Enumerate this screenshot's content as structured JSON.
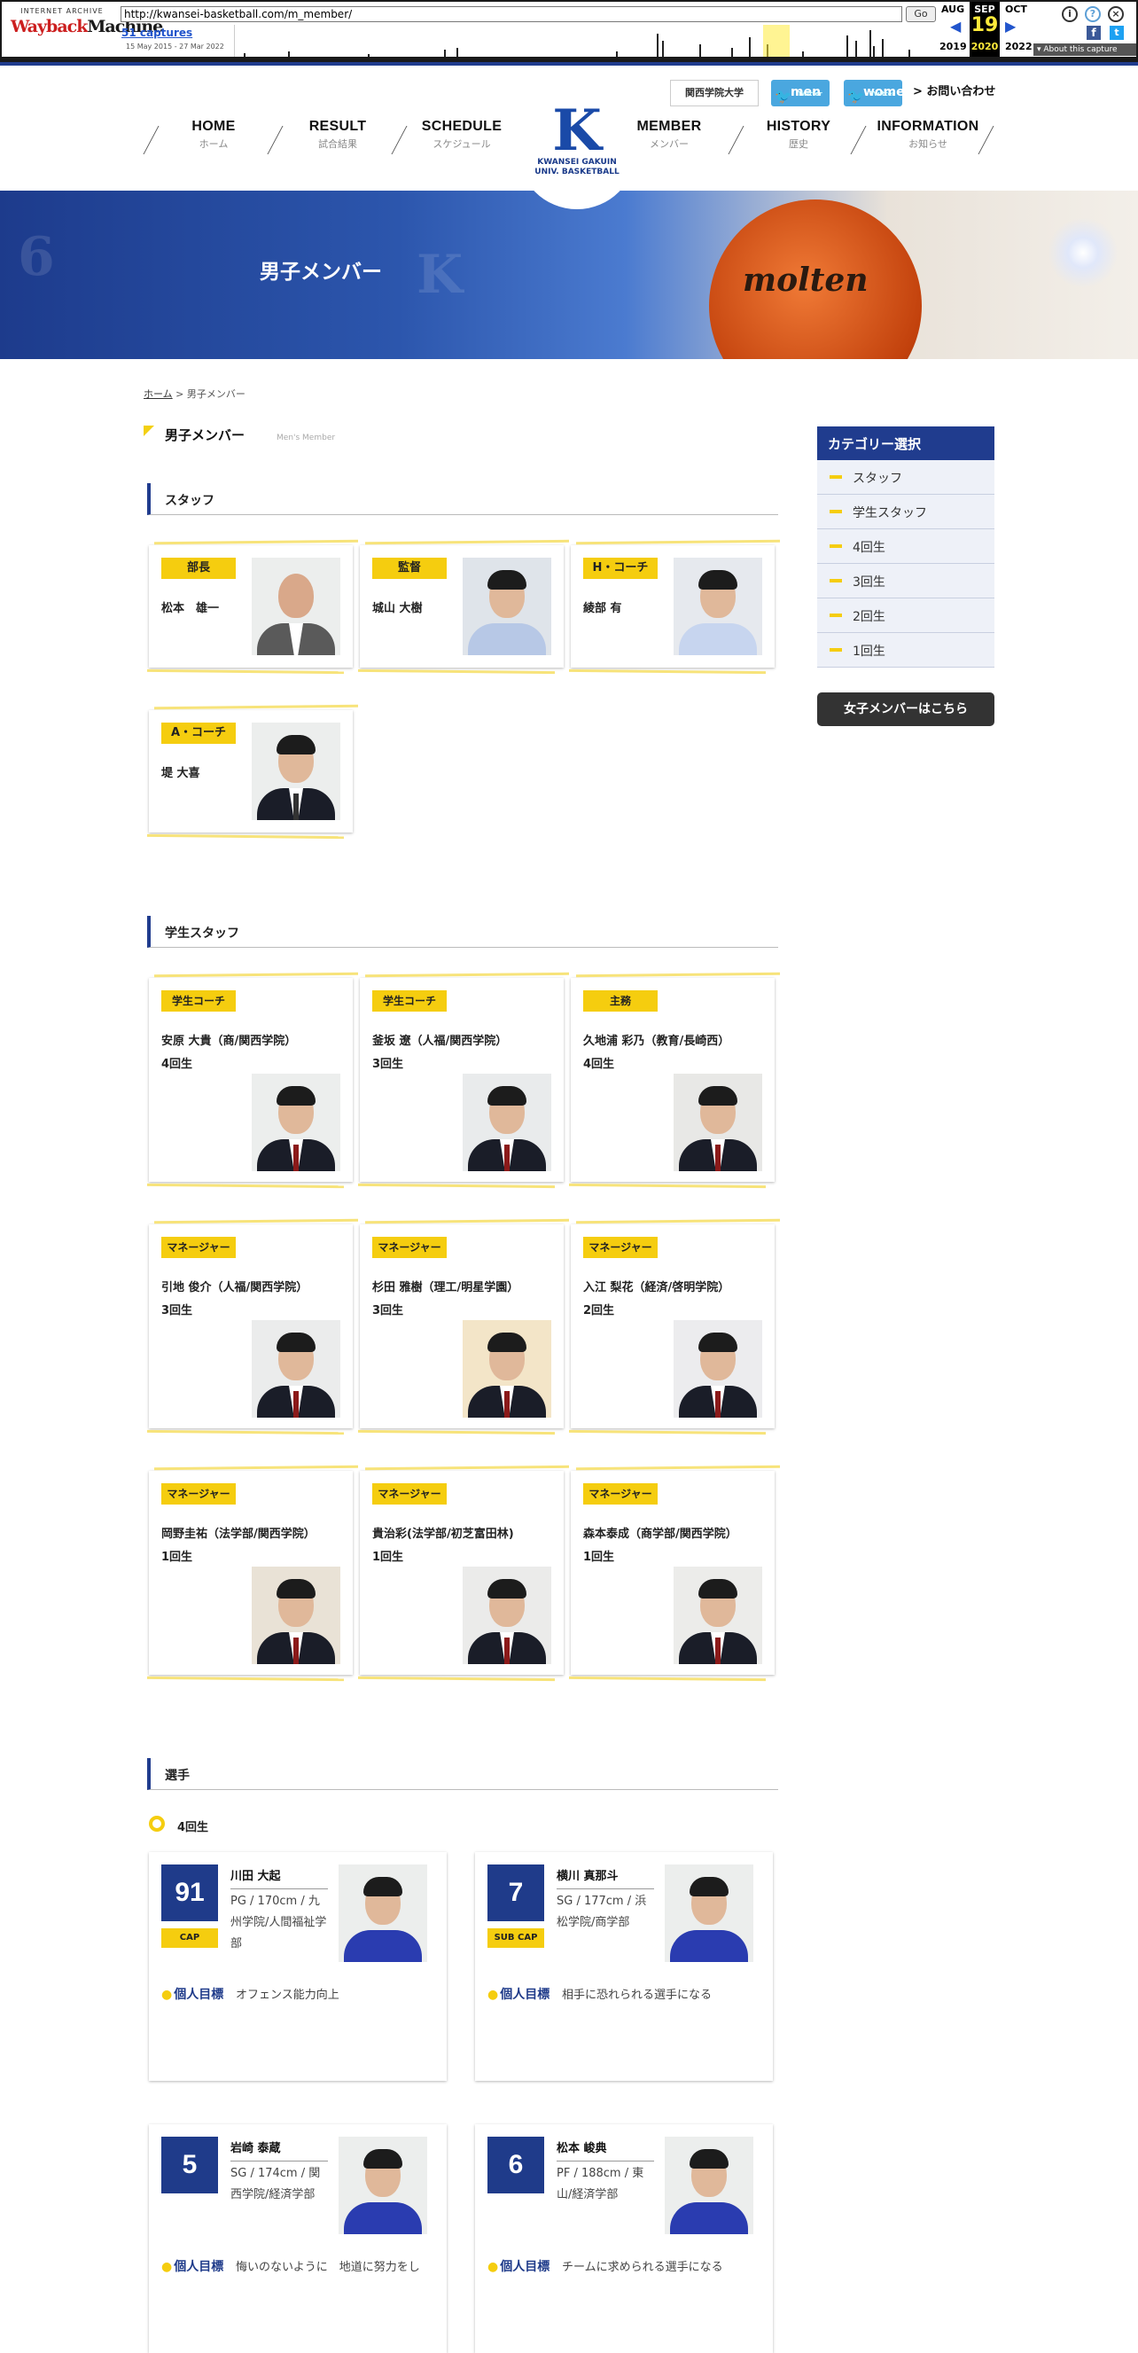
{
  "wayback": {
    "logo_small": "INTERNET ARCHIVE",
    "logo_main_a": "Wayback",
    "logo_main_b": "Machine",
    "url": "http://kwansei-basketball.com/m_member/",
    "go": "Go",
    "captures": "51 captures",
    "range": "15 May 2015 - 27 Mar 2022",
    "prev_month": "AUG",
    "cur_month": "SEP",
    "next_month": "OCT",
    "cur_day": "19",
    "prev_year": "2019",
    "cur_year": "2020",
    "next_year": "2022",
    "about": "▾ About this capture"
  },
  "header": {
    "univ_link": "関西学院大学",
    "twitter_men_small": "Twitter",
    "twitter_men": "men",
    "twitter_women_small": "Twitter",
    "twitter_women": "women",
    "contact": "> お問い合わせ",
    "logo_letter": "K",
    "logo_line1": "KWANSEI GAKUIN",
    "logo_line2": "UNIV. BASKETBALL",
    "nav": [
      {
        "en": "HOME",
        "jp": "ホーム"
      },
      {
        "en": "RESULT",
        "jp": "試合結果"
      },
      {
        "en": "SCHEDULE",
        "jp": "スケジュール"
      },
      {
        "en": "MEMBER",
        "jp": "メンバー"
      },
      {
        "en": "HISTORY",
        "jp": "歴史"
      },
      {
        "en": "INFORMATION",
        "jp": "お知らせ"
      }
    ]
  },
  "banner": {
    "title": "男子メンバー",
    "ball_text": "molten"
  },
  "breadcrumb": {
    "home": "ホーム",
    "sep": " > ",
    "current": "男子メンバー"
  },
  "page": {
    "title": "男子メンバー",
    "subtitle": "Men's Member"
  },
  "sections": {
    "staff": "スタッフ",
    "student_staff": "学生スタッフ",
    "players": "選手"
  },
  "staff": [
    {
      "role": "部長",
      "name": "松本　雄一"
    },
    {
      "role": "監督",
      "name": "城山 大樹"
    },
    {
      "role": "H・コーチ",
      "name": "綾部 有"
    },
    {
      "role": "A・コーチ",
      "name": "堤 大喜"
    }
  ],
  "student_staff": [
    {
      "role": "学生コーチ",
      "name": "安原 大貴（商/関西学院）",
      "year": "4回生"
    },
    {
      "role": "学生コーチ",
      "name": "釜坂 遼（人福/関西学院）",
      "year": "3回生"
    },
    {
      "role": "主務",
      "name": "久地浦 彩乃（教育/長崎西）",
      "year": "4回生"
    },
    {
      "role": "マネージャー",
      "name": "引地 俊介（人福/関西学院）",
      "year": "3回生"
    },
    {
      "role": "マネージャー",
      "name": "杉田 雅樹（理工/明星学園）",
      "year": "3回生"
    },
    {
      "role": "マネージャー",
      "name": "入江 梨花（経済/啓明学院）",
      "year": "2回生"
    },
    {
      "role": "マネージャー",
      "name": "岡野圭祐（法学部/関西学院）",
      "year": "1回生"
    },
    {
      "role": "マネージャー",
      "name": "貴治彩(法学部/初芝富田林)",
      "year": "1回生"
    },
    {
      "role": "マネージャー",
      "name": "森本泰成（商学部/関西学院）",
      "year": "1回生"
    }
  ],
  "sidebar": {
    "header": "カテゴリー選択",
    "items": [
      "スタッフ",
      "学生スタッフ",
      "4回生",
      "3回生",
      "2回生",
      "1回生"
    ],
    "women_button": "女子メンバーはこちら"
  },
  "players_year": "4回生",
  "goal_label": "個人目標",
  "players": [
    {
      "number": "91",
      "tag": "CAP",
      "name": "川田 大起",
      "info": "PG / 170cm / 九州学院/人間福祉学部",
      "goal": "オフェンス能力向上"
    },
    {
      "number": "7",
      "tag": "SUB CAP",
      "name": "横川 真那斗",
      "info": "SG / 177cm / 浜松学院/商学部",
      "goal": "相手に恐れられる選手になる"
    },
    {
      "number": "5",
      "tag": "",
      "name": "岩崎 泰蔵",
      "info": "SG / 174cm / 関西学院/経済学部",
      "goal": "悔いのないように　地道に努力をし"
    },
    {
      "number": "6",
      "tag": "",
      "name": "松本 峻典",
      "info": "PF / 188cm / 東山/経済学部",
      "goal": "チームに求められる選手になる"
    }
  ]
}
